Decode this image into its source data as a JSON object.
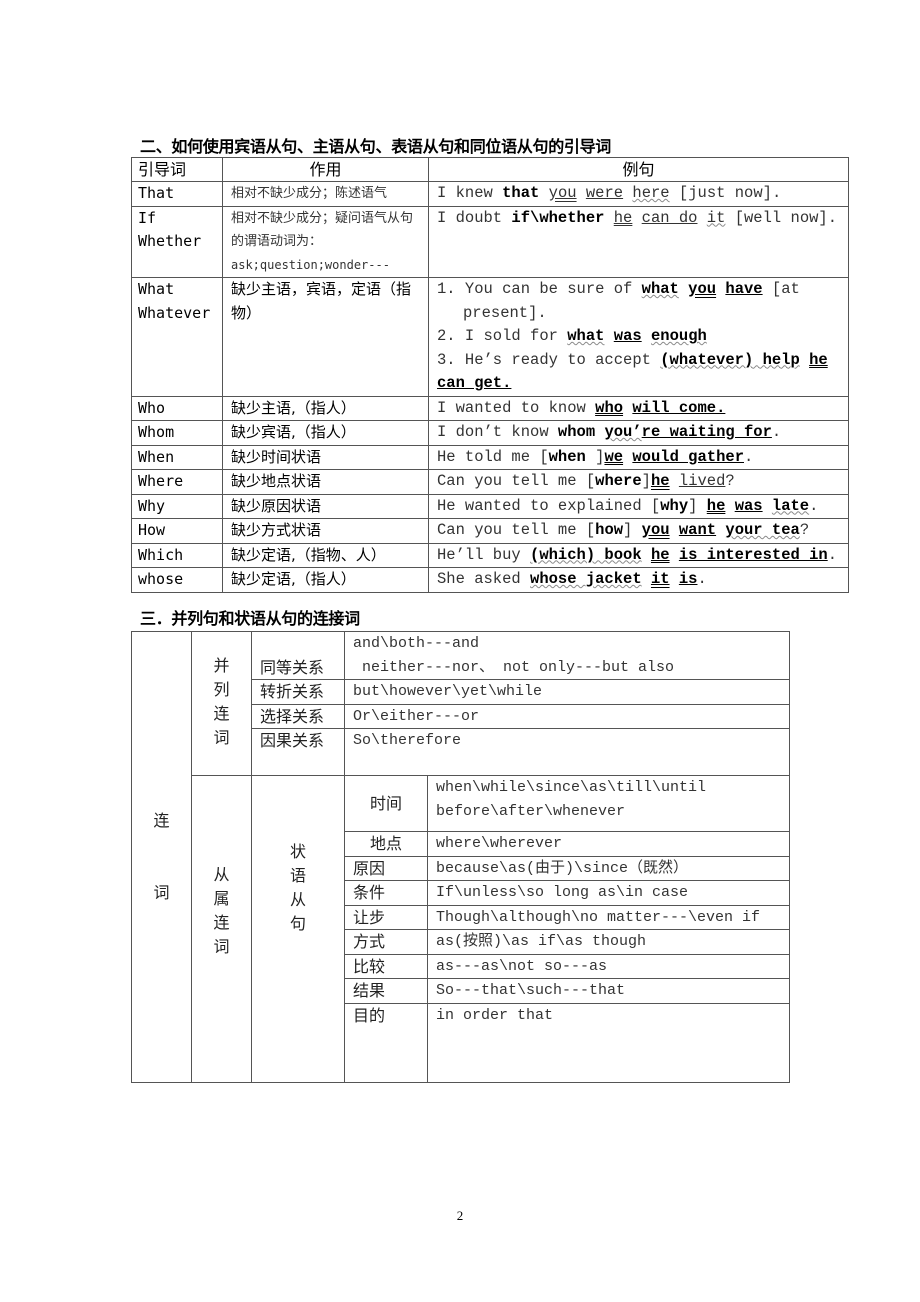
{
  "section2": {
    "title": "二、如何使用宾语从句、主语从句、表语从句和同位语从句的引导词",
    "headers": [
      "引导词",
      "作用",
      "例句"
    ],
    "rows": [
      {
        "word": "That",
        "usage": "相对不缺少成分；陈述语气",
        "example": "I knew that you were here [just now]."
      },
      {
        "word": "If\nWhether",
        "usage": "相对不缺少成分；疑问语气从句的谓语动词为：",
        "usage_note": "ask;question;wonder---",
        "example": "I doubt if\\whether he can do it [well now]."
      },
      {
        "word": "What\nWhatever",
        "usage": "缺少主语，宾语，定语（指物）",
        "examples": [
          "1.  You can be sure of what you have [at present].",
          "2. I sold for what was enough",
          "3. He’s ready to accept (whatever) help he can get."
        ]
      },
      {
        "word": "Who",
        "usage": "缺少主语,（指人）",
        "example": "I wanted to know who will come."
      },
      {
        "word": "Whom",
        "usage": "缺少宾语,（指人）",
        "example": "I don’t know whom you’re waiting for."
      },
      {
        "word": "When",
        "usage": "缺少时间状语",
        "example": "He told me [when ]we would gather."
      },
      {
        "word": "Where",
        "usage": "缺少地点状语",
        "example": "Can you tell me [where]he lived?"
      },
      {
        "word": "Why",
        "usage": "缺少原因状语",
        "example": "He wanted to explained [why] he was late."
      },
      {
        "word": "How",
        "usage": "缺少方式状语",
        "example": "Can you tell me [how] you want your tea?"
      },
      {
        "word": "Which",
        "usage": "缺少定语,（指物、人）",
        "example": "He’ll buy (which) book he is interested in."
      },
      {
        "word": "whose",
        "usage": "缺少定语,（指人）",
        "example": "She asked whose jacket it is."
      }
    ]
  },
  "section3": {
    "title": "三．并列句和状语从句的连接词",
    "root_label": [
      "连",
      "词"
    ],
    "coordinating": {
      "label": [
        "并",
        "列",
        "连",
        "词"
      ],
      "rows": [
        {
          "relation": "同等关系",
          "words": [
            "and\\both---and",
            " neither---nor、 not only---but also"
          ]
        },
        {
          "relation": "转折关系",
          "words": [
            "but\\however\\yet\\while"
          ]
        },
        {
          "relation": "选择关系",
          "words": [
            "Or\\either---or"
          ]
        },
        {
          "relation": "因果关系",
          "words": [
            "So\\therefore"
          ]
        }
      ]
    },
    "subordinating": {
      "label": [
        "从",
        "属",
        "连",
        "词"
      ],
      "clause_label": [
        "状",
        "语",
        "从",
        "句"
      ],
      "rows": [
        {
          "type": "时间",
          "words": [
            "when\\while\\since\\as\\till\\until",
            "before\\after\\whenever"
          ]
        },
        {
          "type": "地点",
          "words": [
            "where\\wherever"
          ]
        },
        {
          "type": "原因",
          "words": [
            "because\\as(由于)\\since（既然）"
          ]
        },
        {
          "type": "条件",
          "words": [
            "If\\unless\\so long as\\in case"
          ]
        },
        {
          "type": "让步",
          "words": [
            "Though\\although\\no matter---\\even if"
          ]
        },
        {
          "type": "方式",
          "words": [
            "as(按照)\\as if\\as though"
          ]
        },
        {
          "type": "比较",
          "words": [
            "as---as\\not so---as"
          ]
        },
        {
          "type": "结果",
          "words": [
            "So---that\\such---that"
          ]
        },
        {
          "type": "目的",
          "words": [
            "in order that"
          ]
        }
      ]
    }
  },
  "page_number": "2"
}
